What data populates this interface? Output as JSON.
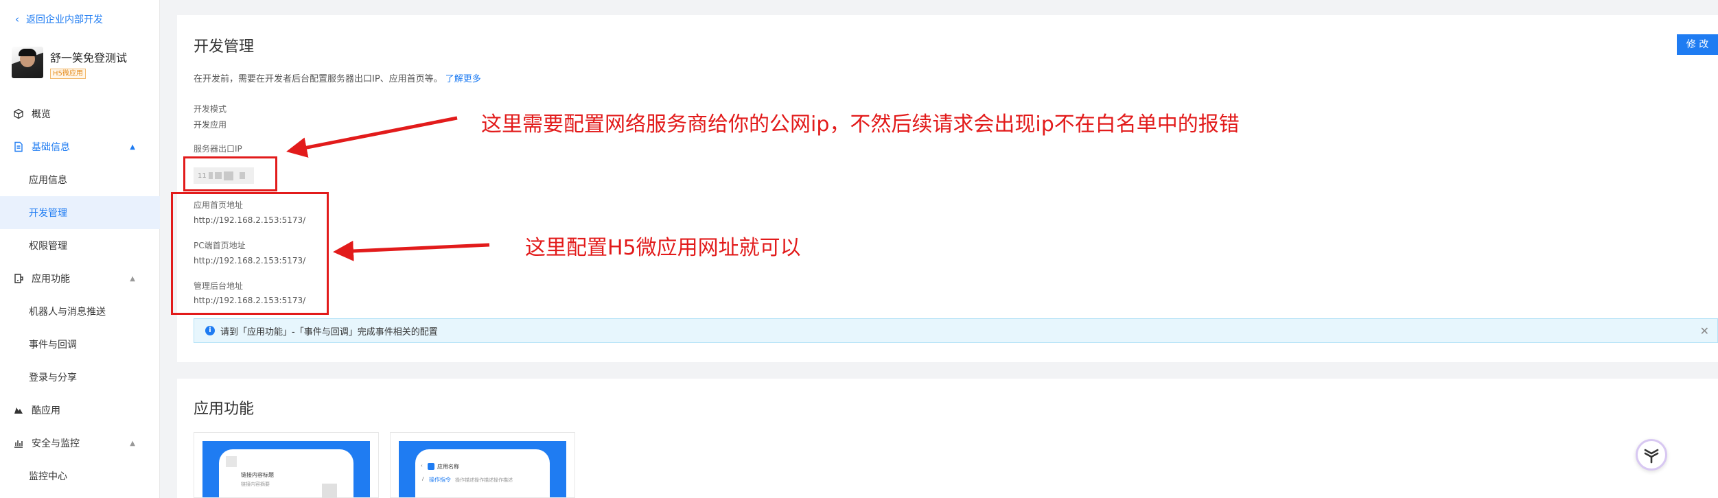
{
  "sidebar": {
    "back_label": "返回企业内部开发",
    "app_name": "舒一笑免登测试",
    "app_badge": "H5微应用",
    "items": [
      {
        "label": "概览",
        "icon": "cube-icon"
      },
      {
        "label": "基础信息",
        "icon": "document-icon"
      },
      {
        "label": "应用信息"
      },
      {
        "label": "开发管理"
      },
      {
        "label": "权限管理"
      },
      {
        "label": "应用功能",
        "icon": "function-icon"
      },
      {
        "label": "机器人与消息推送"
      },
      {
        "label": "事件与回调"
      },
      {
        "label": "登录与分享"
      },
      {
        "label": "酷应用",
        "icon": "cool-app-icon"
      },
      {
        "label": "安全与监控",
        "icon": "chart-icon"
      },
      {
        "label": "监控中心"
      }
    ]
  },
  "dev": {
    "title": "开发管理",
    "edit_label": "修 改",
    "desc": "在开发前，需要在开发者后台配置服务器出口IP、应用首页等。",
    "learn_more": "了解更多",
    "mode_label": "开发模式",
    "mode_value": "开发应用",
    "ip_label": "服务器出口IP",
    "ip_masked_prefix": "11",
    "home_label": "应用首页地址",
    "home_value": "http://192.168.2.153:5173/",
    "pc_label": "PC端首页地址",
    "pc_value": "http://192.168.2.153:5173/",
    "admin_label": "管理后台地址",
    "admin_value": "http://192.168.2.153:5173/",
    "notice": "请到「应用功能」-「事件与回调」完成事件相关的配置"
  },
  "annotations": {
    "ip_note": "这里需要配置网络服务商给你的公网ip，不然后续请求会出现ip不在白名单中的报错",
    "url_note": "这里配置H5微应用网址就可以"
  },
  "features": {
    "title": "应用功能",
    "card1_title": "链接内容标题",
    "card1_sub": "链接内容摘要",
    "card2_title": "应用名称",
    "card2_action": "操作指令",
    "card2_desc": "操作描述操作描述操作描述"
  },
  "colors": {
    "accent": "#1f7cf2",
    "annotation": "#e21b1b",
    "notice_bg": "#e7f6fd"
  }
}
